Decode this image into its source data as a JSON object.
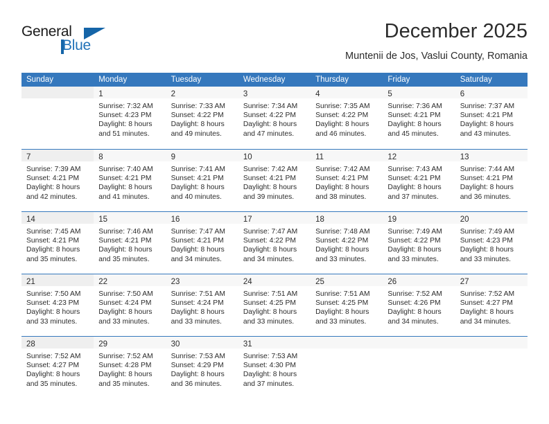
{
  "logo": {
    "primary_text": "General",
    "secondary_text": "Blue",
    "accent_color": "#1565a8"
  },
  "header": {
    "title": "December 2025",
    "subtitle": "Muntenii de Jos, Vaslui County, Romania"
  },
  "calendar": {
    "header_bg": "#3578bd",
    "weekday_headers": [
      "Sunday",
      "Monday",
      "Tuesday",
      "Wednesday",
      "Thursday",
      "Friday",
      "Saturday"
    ],
    "labels": {
      "sunrise_prefix": "Sunrise:",
      "sunset_prefix": "Sunset:",
      "daylight_prefix": "Daylight:"
    },
    "weeks": [
      [
        {
          "day": "",
          "sunrise": "",
          "sunset": "",
          "daylight_line1": "",
          "daylight_line2": ""
        },
        {
          "day": "1",
          "sunrise": "Sunrise: 7:32 AM",
          "sunset": "Sunset: 4:23 PM",
          "daylight_line1": "Daylight: 8 hours",
          "daylight_line2": "and 51 minutes."
        },
        {
          "day": "2",
          "sunrise": "Sunrise: 7:33 AM",
          "sunset": "Sunset: 4:22 PM",
          "daylight_line1": "Daylight: 8 hours",
          "daylight_line2": "and 49 minutes."
        },
        {
          "day": "3",
          "sunrise": "Sunrise: 7:34 AM",
          "sunset": "Sunset: 4:22 PM",
          "daylight_line1": "Daylight: 8 hours",
          "daylight_line2": "and 47 minutes."
        },
        {
          "day": "4",
          "sunrise": "Sunrise: 7:35 AM",
          "sunset": "Sunset: 4:22 PM",
          "daylight_line1": "Daylight: 8 hours",
          "daylight_line2": "and 46 minutes."
        },
        {
          "day": "5",
          "sunrise": "Sunrise: 7:36 AM",
          "sunset": "Sunset: 4:21 PM",
          "daylight_line1": "Daylight: 8 hours",
          "daylight_line2": "and 45 minutes."
        },
        {
          "day": "6",
          "sunrise": "Sunrise: 7:37 AM",
          "sunset": "Sunset: 4:21 PM",
          "daylight_line1": "Daylight: 8 hours",
          "daylight_line2": "and 43 minutes."
        }
      ],
      [
        {
          "day": "7",
          "sunrise": "Sunrise: 7:39 AM",
          "sunset": "Sunset: 4:21 PM",
          "daylight_line1": "Daylight: 8 hours",
          "daylight_line2": "and 42 minutes."
        },
        {
          "day": "8",
          "sunrise": "Sunrise: 7:40 AM",
          "sunset": "Sunset: 4:21 PM",
          "daylight_line1": "Daylight: 8 hours",
          "daylight_line2": "and 41 minutes."
        },
        {
          "day": "9",
          "sunrise": "Sunrise: 7:41 AM",
          "sunset": "Sunset: 4:21 PM",
          "daylight_line1": "Daylight: 8 hours",
          "daylight_line2": "and 40 minutes."
        },
        {
          "day": "10",
          "sunrise": "Sunrise: 7:42 AM",
          "sunset": "Sunset: 4:21 PM",
          "daylight_line1": "Daylight: 8 hours",
          "daylight_line2": "and 39 minutes."
        },
        {
          "day": "11",
          "sunrise": "Sunrise: 7:42 AM",
          "sunset": "Sunset: 4:21 PM",
          "daylight_line1": "Daylight: 8 hours",
          "daylight_line2": "and 38 minutes."
        },
        {
          "day": "12",
          "sunrise": "Sunrise: 7:43 AM",
          "sunset": "Sunset: 4:21 PM",
          "daylight_line1": "Daylight: 8 hours",
          "daylight_line2": "and 37 minutes."
        },
        {
          "day": "13",
          "sunrise": "Sunrise: 7:44 AM",
          "sunset": "Sunset: 4:21 PM",
          "daylight_line1": "Daylight: 8 hours",
          "daylight_line2": "and 36 minutes."
        }
      ],
      [
        {
          "day": "14",
          "sunrise": "Sunrise: 7:45 AM",
          "sunset": "Sunset: 4:21 PM",
          "daylight_line1": "Daylight: 8 hours",
          "daylight_line2": "and 35 minutes."
        },
        {
          "day": "15",
          "sunrise": "Sunrise: 7:46 AM",
          "sunset": "Sunset: 4:21 PM",
          "daylight_line1": "Daylight: 8 hours",
          "daylight_line2": "and 35 minutes."
        },
        {
          "day": "16",
          "sunrise": "Sunrise: 7:47 AM",
          "sunset": "Sunset: 4:21 PM",
          "daylight_line1": "Daylight: 8 hours",
          "daylight_line2": "and 34 minutes."
        },
        {
          "day": "17",
          "sunrise": "Sunrise: 7:47 AM",
          "sunset": "Sunset: 4:22 PM",
          "daylight_line1": "Daylight: 8 hours",
          "daylight_line2": "and 34 minutes."
        },
        {
          "day": "18",
          "sunrise": "Sunrise: 7:48 AM",
          "sunset": "Sunset: 4:22 PM",
          "daylight_line1": "Daylight: 8 hours",
          "daylight_line2": "and 33 minutes."
        },
        {
          "day": "19",
          "sunrise": "Sunrise: 7:49 AM",
          "sunset": "Sunset: 4:22 PM",
          "daylight_line1": "Daylight: 8 hours",
          "daylight_line2": "and 33 minutes."
        },
        {
          "day": "20",
          "sunrise": "Sunrise: 7:49 AM",
          "sunset": "Sunset: 4:23 PM",
          "daylight_line1": "Daylight: 8 hours",
          "daylight_line2": "and 33 minutes."
        }
      ],
      [
        {
          "day": "21",
          "sunrise": "Sunrise: 7:50 AM",
          "sunset": "Sunset: 4:23 PM",
          "daylight_line1": "Daylight: 8 hours",
          "daylight_line2": "and 33 minutes."
        },
        {
          "day": "22",
          "sunrise": "Sunrise: 7:50 AM",
          "sunset": "Sunset: 4:24 PM",
          "daylight_line1": "Daylight: 8 hours",
          "daylight_line2": "and 33 minutes."
        },
        {
          "day": "23",
          "sunrise": "Sunrise: 7:51 AM",
          "sunset": "Sunset: 4:24 PM",
          "daylight_line1": "Daylight: 8 hours",
          "daylight_line2": "and 33 minutes."
        },
        {
          "day": "24",
          "sunrise": "Sunrise: 7:51 AM",
          "sunset": "Sunset: 4:25 PM",
          "daylight_line1": "Daylight: 8 hours",
          "daylight_line2": "and 33 minutes."
        },
        {
          "day": "25",
          "sunrise": "Sunrise: 7:51 AM",
          "sunset": "Sunset: 4:25 PM",
          "daylight_line1": "Daylight: 8 hours",
          "daylight_line2": "and 33 minutes."
        },
        {
          "day": "26",
          "sunrise": "Sunrise: 7:52 AM",
          "sunset": "Sunset: 4:26 PM",
          "daylight_line1": "Daylight: 8 hours",
          "daylight_line2": "and 34 minutes."
        },
        {
          "day": "27",
          "sunrise": "Sunrise: 7:52 AM",
          "sunset": "Sunset: 4:27 PM",
          "daylight_line1": "Daylight: 8 hours",
          "daylight_line2": "and 34 minutes."
        }
      ],
      [
        {
          "day": "28",
          "sunrise": "Sunrise: 7:52 AM",
          "sunset": "Sunset: 4:27 PM",
          "daylight_line1": "Daylight: 8 hours",
          "daylight_line2": "and 35 minutes."
        },
        {
          "day": "29",
          "sunrise": "Sunrise: 7:52 AM",
          "sunset": "Sunset: 4:28 PM",
          "daylight_line1": "Daylight: 8 hours",
          "daylight_line2": "and 35 minutes."
        },
        {
          "day": "30",
          "sunrise": "Sunrise: 7:53 AM",
          "sunset": "Sunset: 4:29 PM",
          "daylight_line1": "Daylight: 8 hours",
          "daylight_line2": "and 36 minutes."
        },
        {
          "day": "31",
          "sunrise": "Sunrise: 7:53 AM",
          "sunset": "Sunset: 4:30 PM",
          "daylight_line1": "Daylight: 8 hours",
          "daylight_line2": "and 37 minutes."
        },
        {
          "day": "",
          "sunrise": "",
          "sunset": "",
          "daylight_line1": "",
          "daylight_line2": ""
        },
        {
          "day": "",
          "sunrise": "",
          "sunset": "",
          "daylight_line1": "",
          "daylight_line2": ""
        },
        {
          "day": "",
          "sunrise": "",
          "sunset": "",
          "daylight_line1": "",
          "daylight_line2": ""
        }
      ]
    ]
  }
}
